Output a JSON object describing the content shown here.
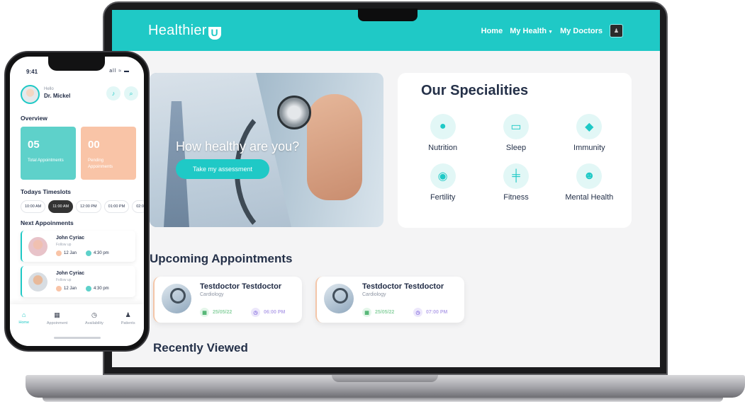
{
  "colors": {
    "accent": "#1fc9c6",
    "dark_text": "#253149",
    "peach": "#f9c4a7",
    "teal_card": "#5ed1ca"
  },
  "laptop": {
    "brand": "Healthier",
    "brand_mark": "U",
    "nav": [
      {
        "label": "Home"
      },
      {
        "label": "My Health",
        "has_dropdown": true
      },
      {
        "label": "My Doctors"
      }
    ],
    "hero": {
      "headline": "How healthy are you?",
      "cta": "Take my assessment"
    },
    "specialities": {
      "title": "Our Specialities",
      "items": [
        {
          "label": "Nutrition",
          "icon": "apple-icon"
        },
        {
          "label": "Sleep",
          "icon": "bed-icon"
        },
        {
          "label": "Immunity",
          "icon": "shield-icon"
        },
        {
          "label": "Fertility",
          "icon": "fertility-icon"
        },
        {
          "label": "Fitness",
          "icon": "dumbbell-icon"
        },
        {
          "label": "Mental Health",
          "icon": "brain-icon"
        }
      ]
    },
    "upcoming": {
      "title": "Upcoming Appointments",
      "cards": [
        {
          "doctor": "Testdoctor Testdoctor",
          "speciality": "Cardiology",
          "date": "25/05/22",
          "time": "06:00 PM"
        },
        {
          "doctor": "Testdoctor Testdoctor",
          "speciality": "Cardiology",
          "date": "25/05/22",
          "time": "07:00 PM"
        }
      ]
    },
    "recent_title": "Recently Viewed"
  },
  "phone": {
    "status_time": "9:41",
    "status_icons": "all ≈ ▬",
    "greeting": "Hello",
    "user_name": "Dr. Mickel",
    "overview_title": "Overview",
    "stats": [
      {
        "value": "05",
        "label": "Total Appointments"
      },
      {
        "value": "00",
        "label": "Pending Appoinments"
      }
    ],
    "timeslots_title": "Todays Timeslots",
    "timeslots": [
      "10:00 AM",
      "11:00 AM",
      "12:00 PM",
      "01:00 PM",
      "02:0"
    ],
    "active_slot": "11:00 AM",
    "next_title": "Next Appoinments",
    "appointments": [
      {
        "name": "John Cyriac",
        "type": "Follow up",
        "date": "12 Jan",
        "time": "4:30 pm"
      },
      {
        "name": "John Cyriac",
        "type": "Follow up",
        "date": "12 Jan",
        "time": "4:30 pm"
      }
    ],
    "tabs": [
      {
        "label": "Home",
        "icon": "home-icon",
        "active": true
      },
      {
        "label": "Appoinment",
        "icon": "calendar-icon"
      },
      {
        "label": "Availability",
        "icon": "clock-icon"
      },
      {
        "label": "Patients",
        "icon": "person-icon"
      }
    ]
  }
}
